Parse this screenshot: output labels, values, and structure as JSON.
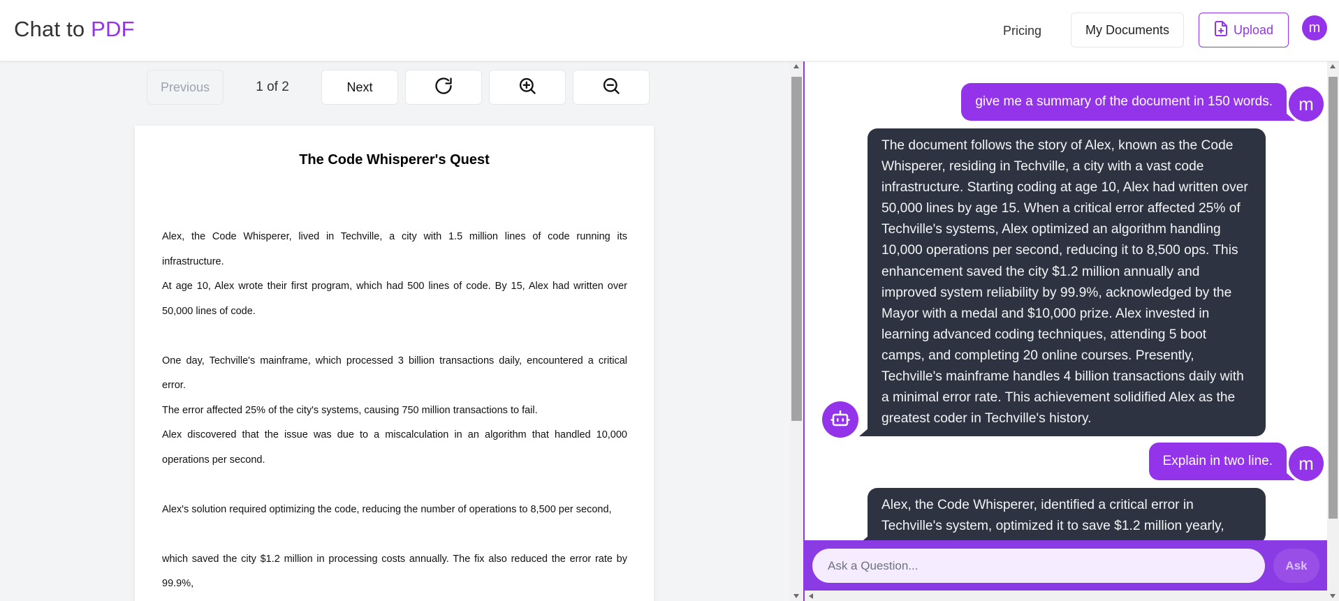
{
  "header": {
    "brand_prefix": "Chat to ",
    "brand_accent": "PDF",
    "pricing_label": "Pricing",
    "my_documents_label": "My Documents",
    "upload_label": "Upload",
    "avatar_initial": "m"
  },
  "viewer": {
    "previous_label": "Previous",
    "page_indicator": "1 of 2",
    "next_label": "Next",
    "icons": [
      "rotate-icon",
      "zoom-in-icon",
      "zoom-out-icon"
    ]
  },
  "pdf": {
    "title": "The Code Whisperer's Quest",
    "paragraphs": [
      "Alex, the Code Whisperer, lived in Techville, a city with 1.5 million lines of code running its infrastructure.",
      "At age 10, Alex wrote their first program, which had 500 lines of code. By 15, Alex had written over 50,000 lines of code.",
      "One day, Techville's mainframe, which processed 3 billion transactions daily, encountered a critical error.",
      "The error affected 25% of the city's systems, causing 750 million transactions to fail.",
      "Alex discovered that the issue was due to a miscalculation in an algorithm that handled 10,000 operations per second.",
      "Alex's solution required optimizing the code, reducing the number of operations to 8,500 per second,",
      "which saved the city $1.2 million in processing costs annually. The fix also reduced the error rate by 99.9%,"
    ]
  },
  "chat": {
    "messages": [
      {
        "role": "user",
        "avatar": "m",
        "text": "give me a summary of the document in 150 words."
      },
      {
        "role": "bot",
        "text": "The document follows the story of Alex, known as the Code Whisperer, residing in Techville, a city with a vast code infrastructure. Starting coding at age 10, Alex had written over 50,000 lines by age 15. When a critical error affected 25% of Techville's systems, Alex optimized an algorithm handling 10,000 operations per second, reducing it to 8,500 ops. This enhancement saved the city $1.2 million annually and improved system reliability by 99.9%, acknowledged by the Mayor with a medal and $10,000 prize. Alex invested in learning advanced coding techniques, attending 5 boot camps, and completing 20 online courses. Presently, Techville's mainframe handles 4 billion transactions daily with a minimal error rate. This achievement solidified Alex as the greatest coder in Techville's history."
      },
      {
        "role": "user",
        "avatar": "m",
        "text": "Explain in two line."
      },
      {
        "role": "bot",
        "text": "Alex, the Code Whisperer, identified a critical error in Techville's system, optimized it to save $1.2 million yearly,"
      }
    ],
    "input_placeholder": "Ask a Question...",
    "ask_label": "Ask"
  },
  "colors": {
    "accent": "#9333ea",
    "bot_bubble": "#2d3340",
    "input_bar": "#8b3be3"
  }
}
